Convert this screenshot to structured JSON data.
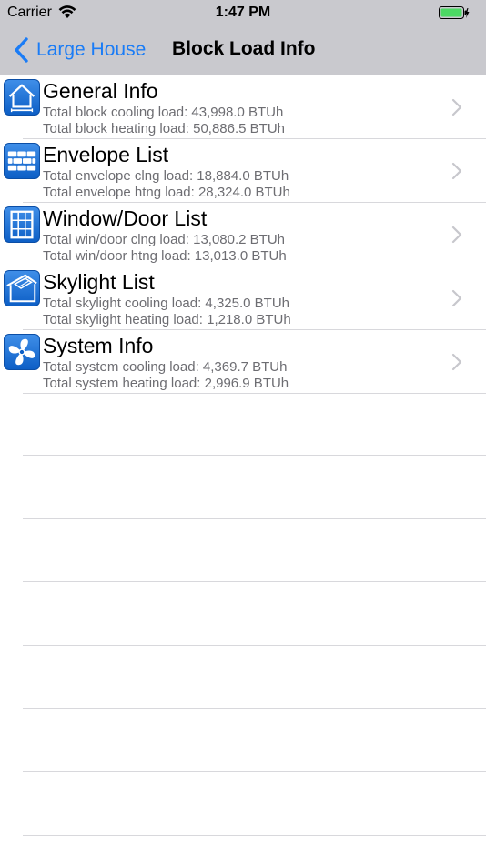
{
  "status_bar": {
    "carrier": "Carrier",
    "time": "1:47 PM"
  },
  "nav": {
    "back_label": "Large House",
    "title": "Block Load Info"
  },
  "colors": {
    "accent": "#1a7cf6",
    "nav_background": "#c9c9ce",
    "battery_green": "#4cd964"
  },
  "rows": [
    {
      "icon": "house-icon",
      "title": "General Info",
      "line1": "Total block cooling load: 43,998.0 BTUh",
      "line2": "Total block heating load: 50,886.5 BTUh"
    },
    {
      "icon": "brick-wall-icon",
      "title": "Envelope List",
      "line1": "Total envelope clng load: 18,884.0 BTUh",
      "line2": "Total envelope htng load: 28,324.0 BTUh"
    },
    {
      "icon": "window-icon",
      "title": "Window/Door List",
      "line1": "Total win/door clng load: 13,080.2 BTUh",
      "line2": "Total win/door htng load: 13,013.0 BTUh"
    },
    {
      "icon": "skylight-icon",
      "title": "Skylight List",
      "line1": "Total skylight cooling load: 4,325.0 BTUh",
      "line2": "Total skylight heating load: 1,218.0 BTUh"
    },
    {
      "icon": "fan-icon",
      "title": "System Info",
      "line1": "Total system cooling load: 4,369.7 BTUh",
      "line2": "Total system heating load: 2,996.9 BTUh"
    }
  ]
}
